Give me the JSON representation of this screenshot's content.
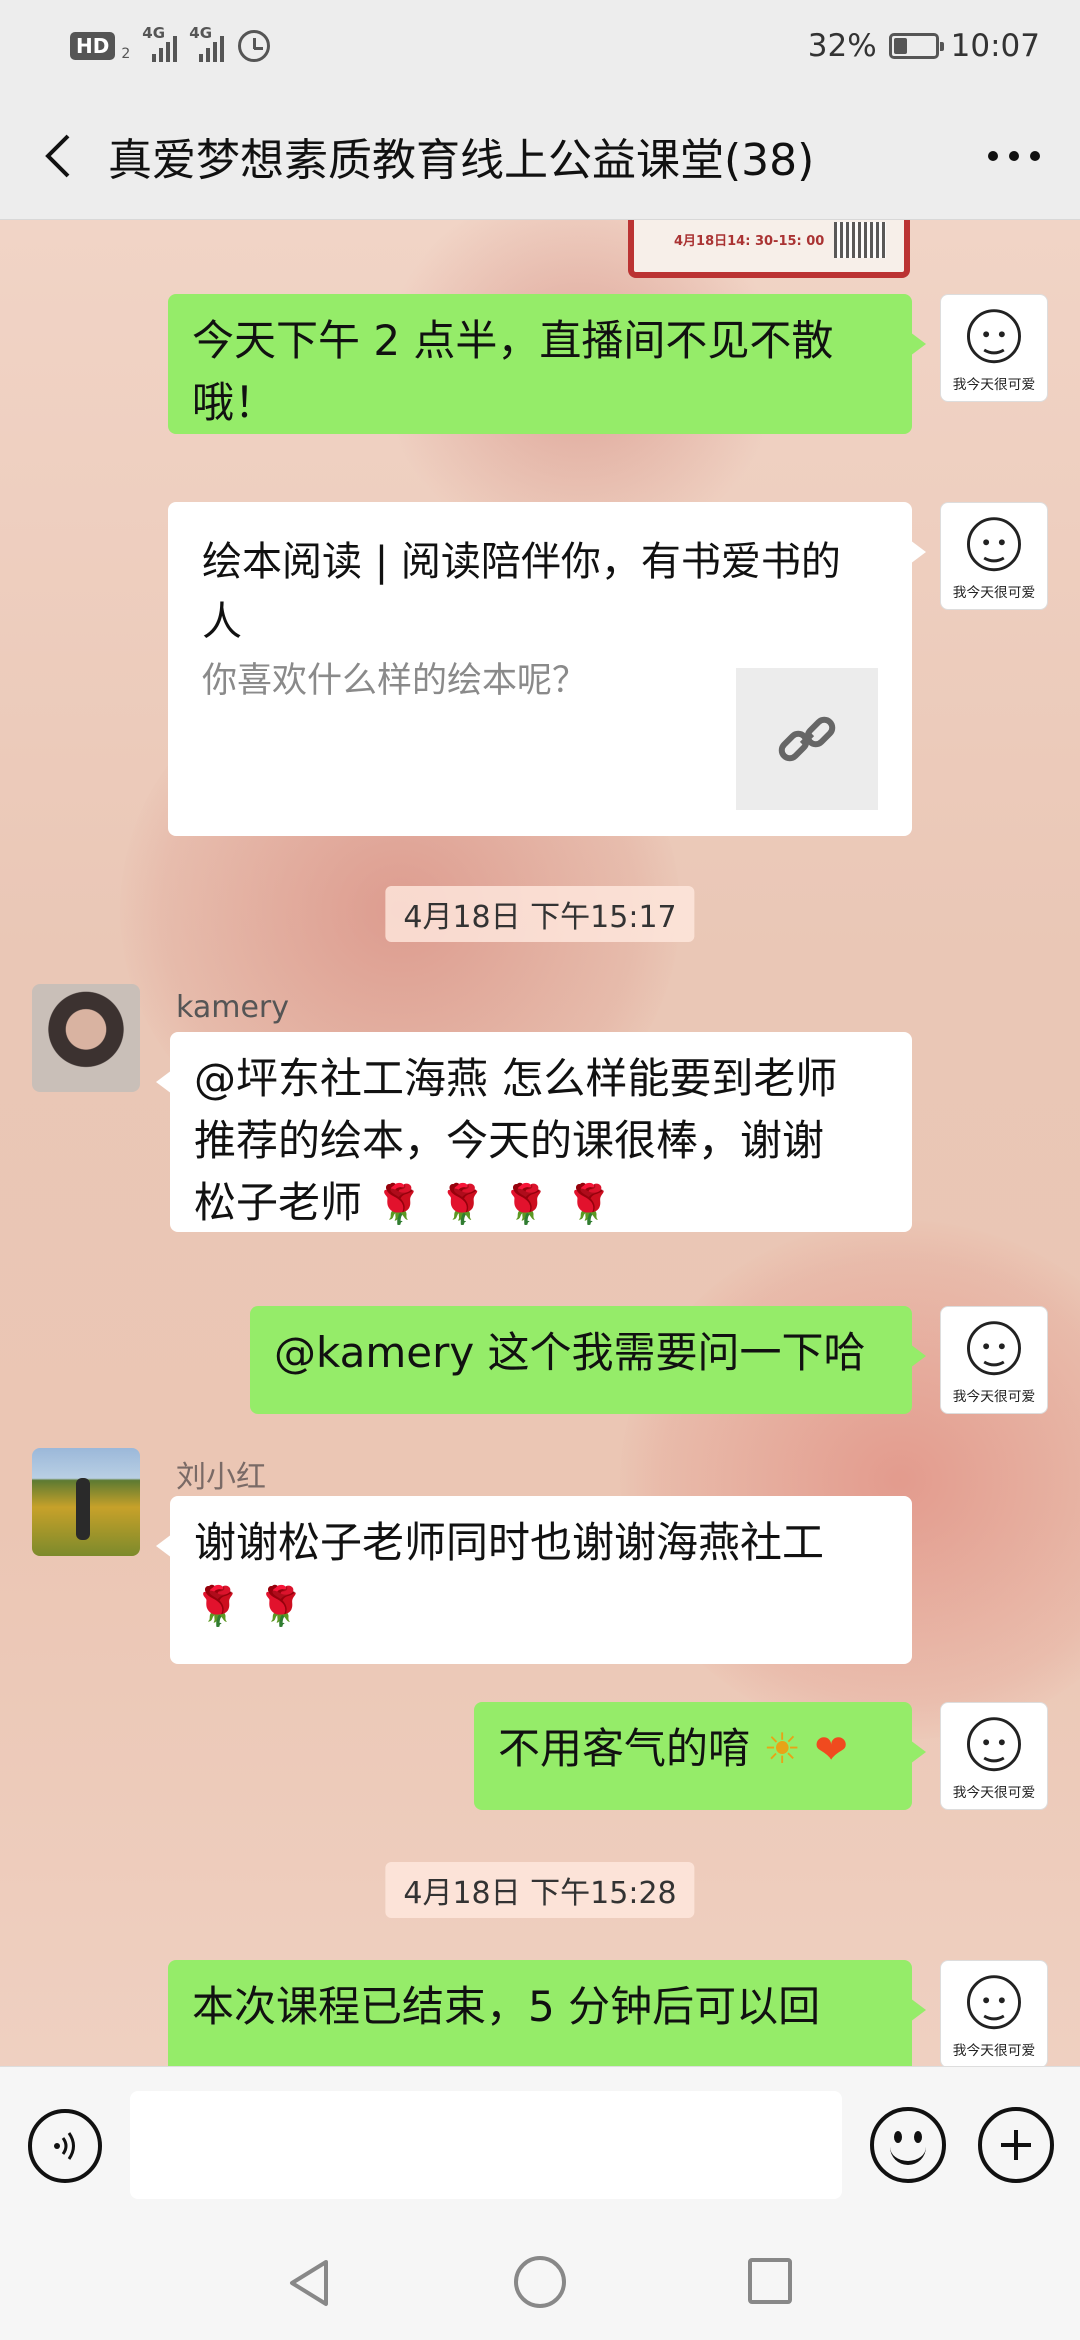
{
  "status_bar": {
    "hd": "HD",
    "hd_sub": "2",
    "net1": "4G",
    "net2": "4G",
    "battery": "32%",
    "time": "10:07"
  },
  "header": {
    "title": "真爱梦想素质教育线上公益课堂(38)"
  },
  "prev_image": {
    "caption": "4月18日14: 30-15: 00"
  },
  "messages": {
    "m1": {
      "line1": "今天下午 2 点半，直播间不见不散",
      "line2": "哦！"
    },
    "link": {
      "title": "绘本阅读 | 阅读陪伴你，有书爱书的人",
      "desc": "你喜欢什么样的绘本呢？"
    },
    "time1": "4月18日 下午15:17",
    "kamery": {
      "name": "kamery",
      "line1": "@坪东社工海燕  怎么样能要到老师",
      "line2": "推荐的绘本，今天的课很棒，谢谢",
      "line3": "松子老师"
    },
    "reply1": "@kamery 这个我需要问一下哈",
    "liu": {
      "name": "刘小红",
      "line1": "谢谢松子老师同时也谢谢海燕社工"
    },
    "reply2": "不用客气的唷",
    "time2": "4月18日 下午15:28",
    "last": "本次课程已结束，5 分钟后可以回"
  },
  "avatar_caption": "我今天很可爱",
  "colors": {
    "bubble_green": "#95ec69",
    "bubble_white": "#ffffff",
    "header_bg": "#ededed"
  }
}
